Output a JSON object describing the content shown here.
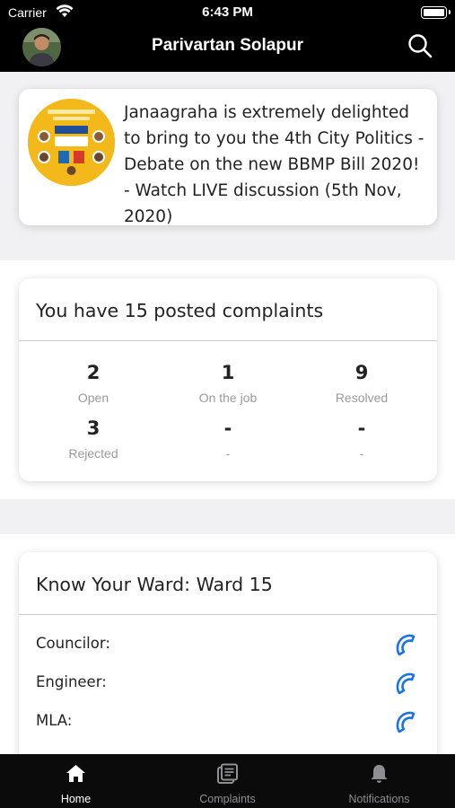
{
  "status_bar": {
    "carrier": "Carrier",
    "time": "6:43 PM"
  },
  "header": {
    "title": "Parivartan Solapur"
  },
  "news": {
    "text": "Janaagraha is extremely delighted to bring to you the 4th City Politics - Debate on the new BBMP Bill 2020! - Watch LIVE discussion (5th Nov, 2020)"
  },
  "complaints": {
    "title": "You have 15 posted complaints",
    "stats": [
      {
        "value": "2",
        "label": "Open"
      },
      {
        "value": "1",
        "label": "On the job"
      },
      {
        "value": "9",
        "label": "Resolved"
      },
      {
        "value": "3",
        "label": "Rejected"
      },
      {
        "value": "-",
        "label": "-"
      },
      {
        "value": "-",
        "label": "-"
      }
    ]
  },
  "ward": {
    "title": "Know Your Ward: Ward 15",
    "rows": [
      {
        "label": "Councilor:"
      },
      {
        "label": "Engineer:"
      },
      {
        "label": "MLA:"
      }
    ]
  },
  "tabs": [
    {
      "label": "Home",
      "icon": "home-icon"
    },
    {
      "label": "Complaints",
      "icon": "complaints-icon"
    },
    {
      "label": "Notifications",
      "icon": "bell-icon"
    }
  ],
  "colors": {
    "accent": "#1a73e8",
    "bar": "#000000",
    "muted": "#9a9a9a"
  }
}
